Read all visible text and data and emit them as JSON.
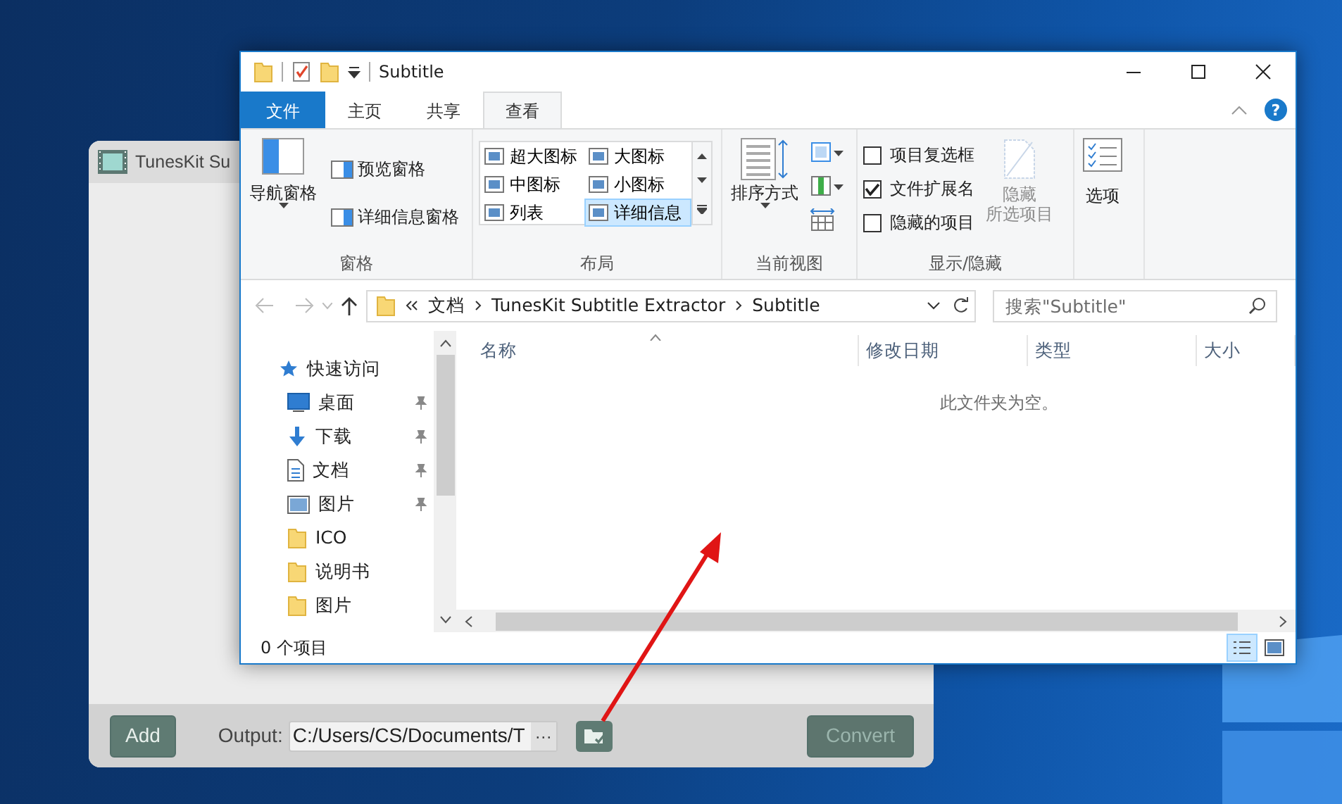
{
  "app_window": {
    "title": "TunesKit Su",
    "add_button": "Add",
    "output_label": "Output:",
    "output_path": "C:/Users/CS/Documents/T",
    "browse_button": "···",
    "convert_button": "Convert",
    "convert_disabled": true
  },
  "explorer": {
    "title": "Subtitle",
    "tabs": [
      {
        "label": "文件",
        "kind": "file",
        "selected": false
      },
      {
        "label": "主页",
        "kind": "tab",
        "selected": false
      },
      {
        "label": "共享",
        "kind": "tab",
        "selected": false
      },
      {
        "label": "查看",
        "kind": "tab",
        "selected": true
      }
    ],
    "help_glyph": "?",
    "ribbon_groups": [
      {
        "kind": "panes",
        "label": "窗格",
        "large": "导航窗格",
        "items": [
          "预览窗格",
          "详细信息窗格"
        ]
      },
      {
        "kind": "layout",
        "label": "布局",
        "options": [
          {
            "label": "超大图标",
            "selected": false
          },
          {
            "label": "大图标",
            "selected": false
          },
          {
            "label": "中图标",
            "selected": false
          },
          {
            "label": "小图标",
            "selected": false
          },
          {
            "label": "列表",
            "selected": false
          },
          {
            "label": "详细信息",
            "selected": true
          }
        ]
      },
      {
        "kind": "view",
        "label": "当前视图",
        "large": "排序方式"
      },
      {
        "kind": "showhide",
        "label": "显示/隐藏",
        "checks": [
          {
            "label": "项目复选框",
            "checked": false
          },
          {
            "label": "文件扩展名",
            "checked": true
          },
          {
            "label": "隐藏的项目",
            "checked": false
          }
        ],
        "large_lines": [
          "隐藏",
          "所选项目"
        ],
        "large_disabled": true
      },
      {
        "kind": "options",
        "large": "选项"
      }
    ],
    "breadcrumbs": [
      "文档",
      "TunesKit Subtitle Extractor",
      "Subtitle"
    ],
    "search_placeholder": "搜索\"Subtitle\"",
    "nav": [
      {
        "label": "快速访问",
        "kind": "star",
        "children": [
          {
            "label": "桌面",
            "kind": "desktop",
            "pinned": true
          },
          {
            "label": "下载",
            "kind": "download",
            "pinned": true
          },
          {
            "label": "文档",
            "kind": "document",
            "pinned": true
          },
          {
            "label": "图片",
            "kind": "picture",
            "pinned": true
          },
          {
            "label": "ICO",
            "kind": "folder",
            "pinned": false
          },
          {
            "label": "说明书",
            "kind": "folder",
            "pinned": false
          },
          {
            "label": "图片",
            "kind": "folder",
            "pinned": false
          }
        ]
      }
    ],
    "columns": [
      "名称",
      "修改日期",
      "类型",
      "大小"
    ],
    "empty_message": "此文件夹为空。",
    "status": "0 个项目",
    "view_buttons": [
      {
        "kind": "details",
        "selected": true
      },
      {
        "kind": "thumbnails",
        "selected": false
      }
    ]
  }
}
